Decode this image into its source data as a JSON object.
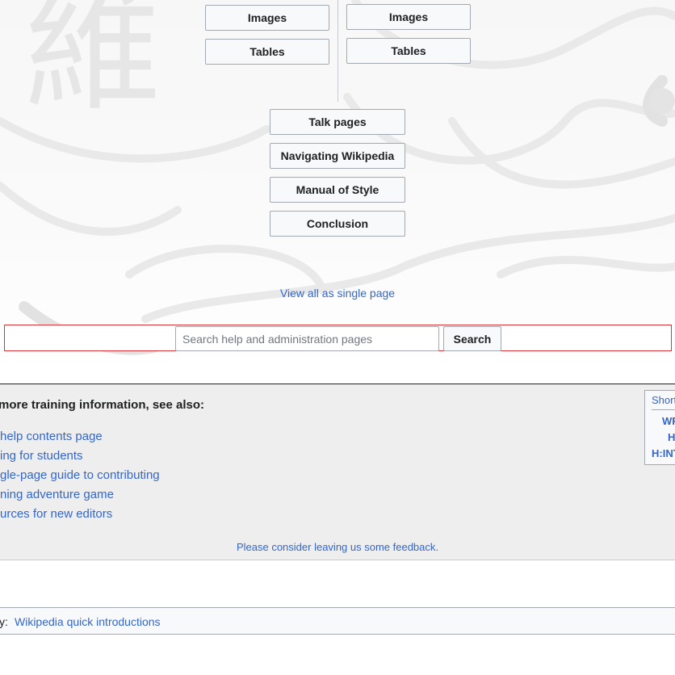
{
  "nav_buttons": {
    "left_col": [
      "Images",
      "Tables"
    ],
    "right_col": [
      "Images",
      "Tables"
    ],
    "center": [
      "Talk pages",
      "Navigating Wikipedia",
      "Manual of Style",
      "Conclusion"
    ]
  },
  "single_page_link": "View all as single page",
  "search": {
    "placeholder": "Search help and administration pages",
    "value": "",
    "button_label": "Search"
  },
  "see_also": {
    "heading": "more training information, see also:",
    "links": [
      "help contents page",
      "ing for students",
      "gle-page guide to contributing",
      "ning adventure game",
      "urces for new editors"
    ],
    "feedback": "Please consider leaving us some feedback."
  },
  "shortcut_box": {
    "title": "Short",
    "links": [
      "WF",
      "H",
      "H:INT"
    ]
  },
  "category_bar": {
    "label": "y:",
    "link": "Wikipedia quick introductions"
  },
  "colors": {
    "link": "#3366cc",
    "text": "#202122",
    "panel_bg": "#eeeeee",
    "highlight_border": "#dd3333"
  },
  "background_glyph": "維"
}
